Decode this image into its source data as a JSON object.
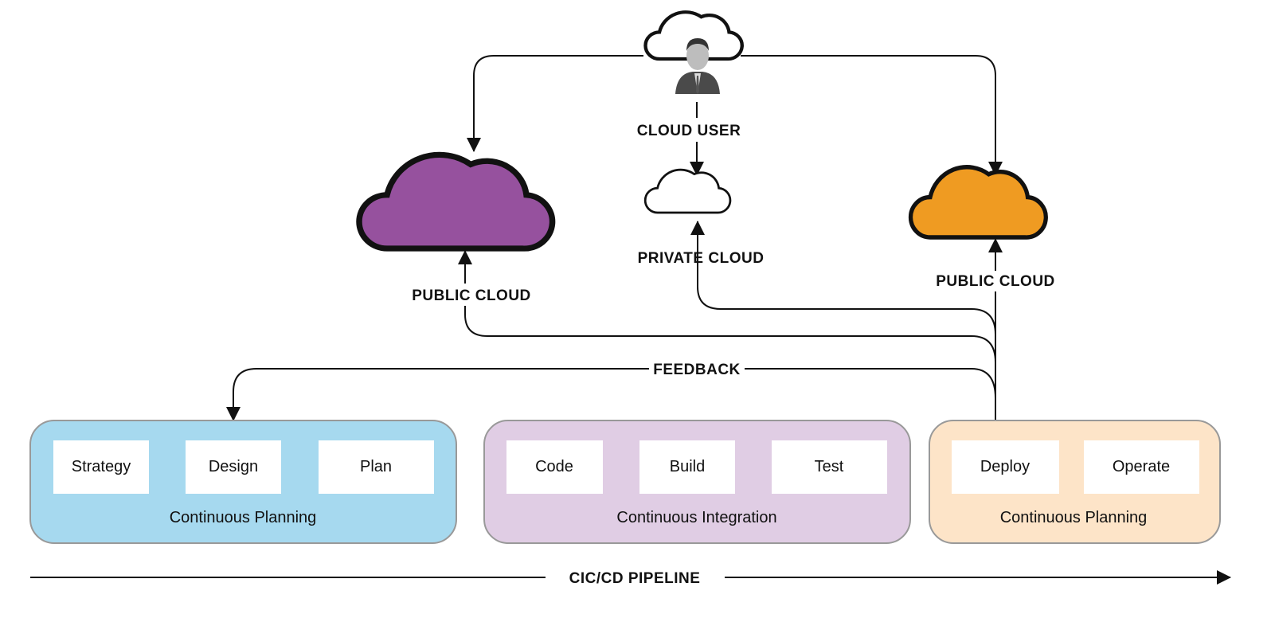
{
  "colors": {
    "planning_box": "#a6d9ef",
    "integration_box": "#e0cde4",
    "deploy_box": "#fde4c8",
    "public_cloud_left": "#96519e",
    "public_cloud_right": "#ef9b22"
  },
  "top": {
    "cloud_user_label": "CLOUD USER",
    "user_icon": "businessman-avatar-icon"
  },
  "clouds": {
    "left_public": "PUBLIC CLOUD",
    "private": "PRIVATE CLOUD",
    "right_public": "PUBLIC CLOUD"
  },
  "feedback_label": "FEEDBACK",
  "stages": [
    {
      "label": "Continuous Planning",
      "items": [
        "Strategy",
        "Design",
        "Plan"
      ]
    },
    {
      "label": "Continuous Integration",
      "items": [
        "Code",
        "Build",
        "Test"
      ]
    },
    {
      "label": "Continuous Planning",
      "items": [
        "Deploy",
        "Operate"
      ]
    }
  ],
  "pipeline_label": "CIC/CD PIPELINE"
}
